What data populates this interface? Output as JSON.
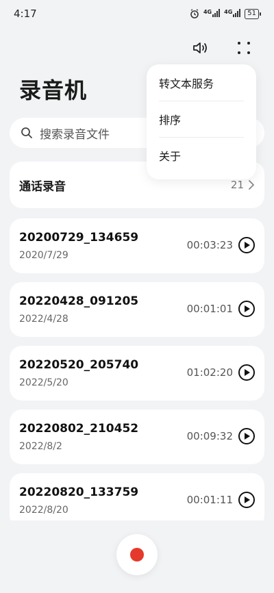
{
  "status_bar": {
    "time": "4:17",
    "network_1": "4G",
    "network_2": "4G",
    "battery": "51"
  },
  "header": {
    "title": "录音机",
    "icons": [
      "speaker-icon",
      "more-dots-icon"
    ]
  },
  "search": {
    "placeholder": "搜索录音文件"
  },
  "call_recordings": {
    "label": "通话录音",
    "count": "21"
  },
  "recordings": [
    {
      "name": "20200729_134659",
      "date": "2020/7/29",
      "duration": "00:03:23"
    },
    {
      "name": "20220428_091205",
      "date": "2022/4/28",
      "duration": "00:01:01"
    },
    {
      "name": "20220520_205740",
      "date": "2022/5/20",
      "duration": "01:02:20"
    },
    {
      "name": "20220802_210452",
      "date": "2022/8/2",
      "duration": "00:09:32"
    },
    {
      "name": "20220820_133759",
      "date": "2022/8/20",
      "duration": "00:01:11"
    }
  ],
  "menu": {
    "items": [
      "转文本服务",
      "排序",
      "关于"
    ]
  },
  "colors": {
    "background": "#f1f3f5",
    "record": "#e5392b"
  }
}
